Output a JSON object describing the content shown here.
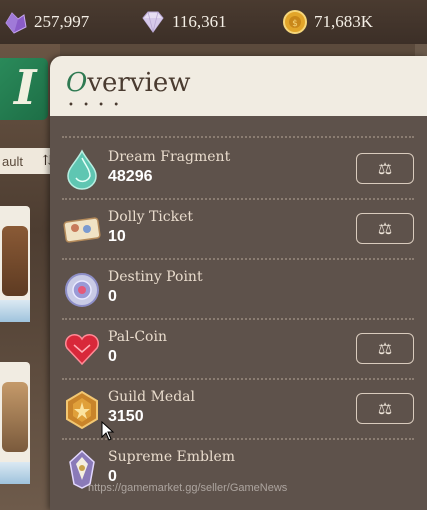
{
  "currencies": [
    {
      "icon": "purple-crystal-icon",
      "value": "257,997"
    },
    {
      "icon": "diamond-icon",
      "value": "116,361"
    },
    {
      "icon": "gold-coin-icon",
      "value": "71,683K"
    }
  ],
  "background": {
    "tab_letter": "I",
    "sort_label": "ault"
  },
  "panel": {
    "title_first_letter": "O",
    "title_rest": "verview",
    "dots": "• • • •"
  },
  "items": [
    {
      "name": "Dream Fragment",
      "amount": "48296",
      "icon": "teardrop-gem-icon",
      "has_exchange": true
    },
    {
      "name": "Dolly Ticket",
      "amount": "10",
      "icon": "ticket-icon",
      "has_exchange": true
    },
    {
      "name": "Destiny Point",
      "amount": "0",
      "icon": "destiny-orb-icon",
      "has_exchange": false
    },
    {
      "name": "Pal-Coin",
      "amount": "0",
      "icon": "heart-gem-icon",
      "has_exchange": true
    },
    {
      "name": "Guild Medal",
      "amount": "3150",
      "icon": "guild-medal-icon",
      "has_exchange": true
    },
    {
      "name": "Supreme Emblem",
      "amount": "0",
      "icon": "emblem-icon",
      "has_exchange": false
    }
  ],
  "exchange_icon": "⚖",
  "watermark": "https://gamemarket.gg/seller/GameNews",
  "colors": {
    "accent_green": "#2f7a52",
    "panel_bg": "#5e524b",
    "header_bg": "#f1ece2"
  }
}
